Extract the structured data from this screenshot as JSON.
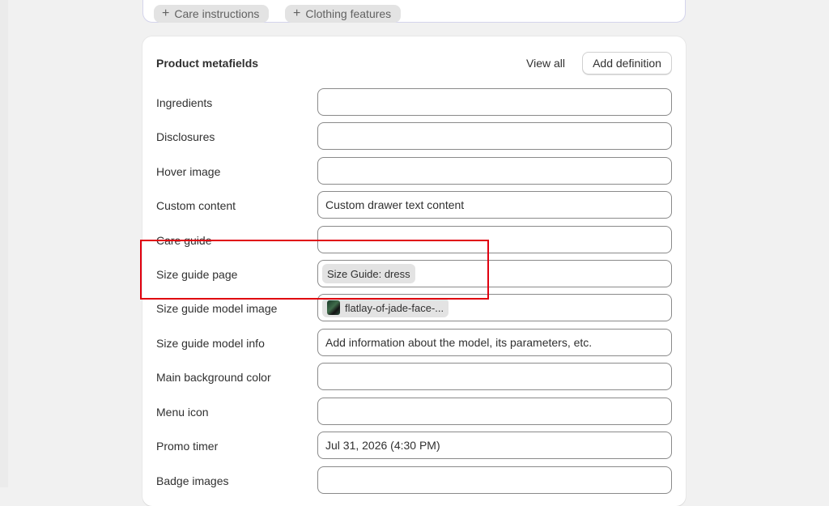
{
  "top_chips": [
    {
      "label": "Care instructions"
    },
    {
      "label": "Clothing features"
    }
  ],
  "card": {
    "title": "Product metafields",
    "view_all": "View all",
    "add_definition": "Add definition"
  },
  "rows": [
    {
      "label": "Ingredients",
      "value": ""
    },
    {
      "label": "Disclosures",
      "value": ""
    },
    {
      "label": "Hover image",
      "value": ""
    },
    {
      "label": "Custom content",
      "value": "Custom drawer text content"
    },
    {
      "label": "Care guide",
      "value": ""
    },
    {
      "label": "Size guide page",
      "chip": "Size Guide: dress"
    },
    {
      "label": "Size guide model image",
      "chip": "flatlay-of-jade-face-..."
    },
    {
      "label": "Size guide model info",
      "value": "Add information about the model, its parameters, etc."
    },
    {
      "label": "Main background color",
      "value": ""
    },
    {
      "label": "Menu icon",
      "value": ""
    },
    {
      "label": "Promo timer",
      "value": "Jul 31, 2026 (4:30 PM)"
    },
    {
      "label": "Badge images",
      "value": ""
    }
  ],
  "colors": {
    "highlight": "#e0000f",
    "field_border": "#8a8a8a",
    "chip_bg": "#e3e3e3"
  }
}
